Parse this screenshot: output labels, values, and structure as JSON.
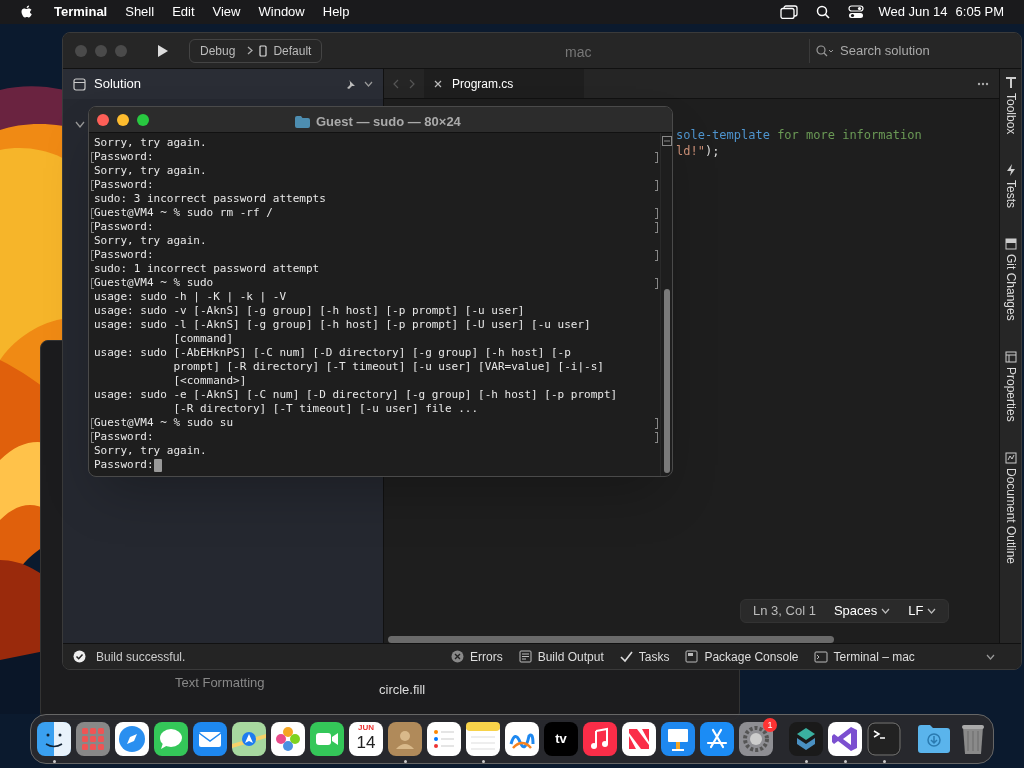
{
  "menu_bar": {
    "app": "Terminal",
    "items": [
      "Shell",
      "Edit",
      "View",
      "Window",
      "Help"
    ],
    "date": "Wed Jun 14",
    "time": "6:05 PM"
  },
  "ide": {
    "title": "mac",
    "config": "Debug",
    "device": "Default",
    "search": {
      "placeholder": "Search solution"
    },
    "solution_panel": {
      "title": "Solution"
    },
    "tabs": [
      {
        "label": "Program.cs",
        "selected": true
      }
    ],
    "code_lines": [
      [
        {
          "kind": "link",
          "text": "sole-template"
        },
        {
          "kind": "comment",
          "text": " for more information"
        }
      ],
      [
        {
          "kind": "string",
          "text": "ld!\""
        },
        {
          "kind": "plain",
          "text": ");"
        }
      ]
    ],
    "side_tabs": [
      "Toolbox",
      "Tests",
      "Git Changes",
      "Properties",
      "Document Outline"
    ],
    "status": {
      "position": "Ln 3, Col 1",
      "indent": "Spaces",
      "line_ending": "LF"
    },
    "build_status": "Build successful.",
    "pads": [
      "Errors",
      "Build Output",
      "Tasks",
      "Package Console",
      "Terminal – mac"
    ]
  },
  "back_window": {
    "items": [
      "Text Formatting",
      "circle.fill"
    ]
  },
  "terminal": {
    "title": "Guest — sudo — 80×24",
    "lines": [
      {
        "text": "Sorry, try again.",
        "marked": false
      },
      {
        "text": "Password:",
        "marked": true
      },
      {
        "text": "Sorry, try again.",
        "marked": false
      },
      {
        "text": "Password:",
        "marked": true
      },
      {
        "text": "sudo: 3 incorrect password attempts",
        "marked": false
      },
      {
        "text": "Guest@VM4 ~ % sudo rm -rf /",
        "marked": true
      },
      {
        "text": "Password:",
        "marked": true
      },
      {
        "text": "Sorry, try again.",
        "marked": false
      },
      {
        "text": "Password:",
        "marked": true
      },
      {
        "text": "sudo: 1 incorrect password attempt",
        "marked": false
      },
      {
        "text": "Guest@VM4 ~ % sudo",
        "marked": true
      },
      {
        "text": "usage: sudo -h | -K | -k | -V",
        "marked": false
      },
      {
        "text": "usage: sudo -v [-AknS] [-g group] [-h host] [-p prompt] [-u user]",
        "marked": false
      },
      {
        "text": "usage: sudo -l [-AknS] [-g group] [-h host] [-p prompt] [-U user] [-u user]",
        "marked": false
      },
      {
        "text": "            [command]",
        "marked": false
      },
      {
        "text": "usage: sudo [-AbEHknPS] [-C num] [-D directory] [-g group] [-h host] [-p",
        "marked": false
      },
      {
        "text": "            prompt] [-R directory] [-T timeout] [-u user] [VAR=value] [-i|-s]",
        "marked": false
      },
      {
        "text": "            [<command>]",
        "marked": false
      },
      {
        "text": "usage: sudo -e [-AknS] [-C num] [-D directory] [-g group] [-h host] [-p prompt]",
        "marked": false
      },
      {
        "text": "            [-R directory] [-T timeout] [-u user] file ...",
        "marked": false
      },
      {
        "text": "Guest@VM4 ~ % sudo su",
        "marked": true
      },
      {
        "text": "Password:",
        "marked": true
      },
      {
        "text": "Sorry, try again.",
        "marked": false
      },
      {
        "text": "Password:",
        "marked": false,
        "cursor": true
      }
    ]
  },
  "dock": [
    {
      "kind": "finder",
      "running": true
    },
    {
      "kind": "launchpad",
      "running": false
    },
    {
      "kind": "safari",
      "running": false
    },
    {
      "kind": "messages",
      "running": false
    },
    {
      "kind": "mail",
      "running": false
    },
    {
      "kind": "maps",
      "running": false
    },
    {
      "kind": "photos",
      "running": false
    },
    {
      "kind": "facetime",
      "running": false
    },
    {
      "kind": "calendar",
      "running": false,
      "month": "JUN",
      "day": "14"
    },
    {
      "kind": "contacts",
      "running": true
    },
    {
      "kind": "reminders",
      "running": false
    },
    {
      "kind": "notes",
      "running": true
    },
    {
      "kind": "freeform",
      "running": false
    },
    {
      "kind": "tv",
      "running": false,
      "label": "tv"
    },
    {
      "kind": "music",
      "running": false
    },
    {
      "kind": "news",
      "running": false
    },
    {
      "kind": "keynote",
      "running": false
    },
    {
      "kind": "appstore",
      "running": false
    },
    {
      "kind": "settings",
      "running": false,
      "badge": "1"
    },
    {
      "kind": "separator"
    },
    {
      "kind": "helper",
      "running": true
    },
    {
      "kind": "visualstudio",
      "running": true
    },
    {
      "kind": "terminal",
      "running": true
    },
    {
      "kind": "separator"
    },
    {
      "kind": "downloads",
      "running": false
    },
    {
      "kind": "trash",
      "running": false
    }
  ]
}
